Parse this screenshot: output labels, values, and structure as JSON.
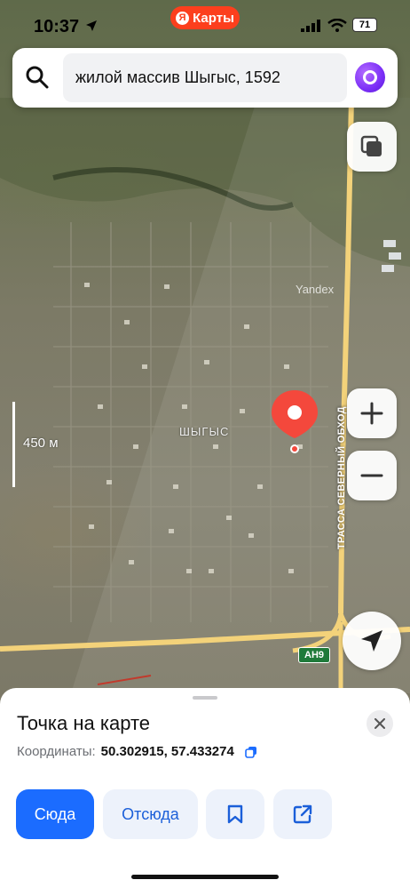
{
  "status_bar": {
    "time": "10:37",
    "brand_letter": "Я",
    "brand_label": "Карты",
    "battery": "71"
  },
  "search": {
    "query": "жилой массив Шыгыс, 1592"
  },
  "map": {
    "scale_label": "450 м",
    "place_label": "ШЫГЫС",
    "road_label_vertical": "ТРАССА СЕВЕРНЫЙ ОБХОД",
    "road_label_top": "ТРАССА СЕВЕРНЫЙ ОБХОД",
    "watermark": "Yandex",
    "route_badge": "АН9",
    "pin_color": "#f4483c"
  },
  "sheet": {
    "title": "Точка на карте",
    "coords_label": "Координаты:",
    "coords_value": "50.302915, 57.433274",
    "buttons": {
      "here": "Сюда",
      "from": "Отсюда"
    }
  },
  "colors": {
    "accent": "#1b6cff",
    "brand": "#fc3f1d",
    "road": "#f3d27a"
  },
  "icons": [
    "location-arrow-icon",
    "signal-icon",
    "wifi-icon",
    "search-icon",
    "alice-icon",
    "layers-icon",
    "plus-icon",
    "minus-icon",
    "navigation-arrow-icon",
    "close-icon",
    "copy-icon",
    "bookmark-icon",
    "share-icon"
  ]
}
